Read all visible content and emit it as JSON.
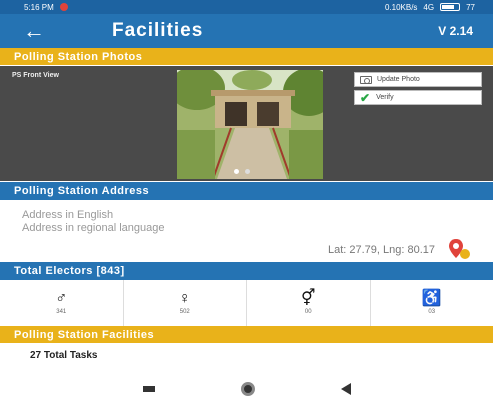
{
  "status_bar": {
    "time": "5:16 PM",
    "network": "0.10KB/s",
    "signal": "4G",
    "battery": "77"
  },
  "app_bar": {
    "title": "Facilities",
    "version": "V 2.14"
  },
  "photos": {
    "header": "Polling Station Photos",
    "label": "PS Front View",
    "update_label": "Update Photo",
    "verify_label": "Verify",
    "photo_count": 2,
    "active_index": 0
  },
  "address": {
    "header": "Polling Station Address",
    "english": "Address in English",
    "regional": "Address in regional language",
    "latlng": "Lat: 27.79, Lng: 80.17"
  },
  "electors": {
    "header": "Total Electors [843]",
    "items": [
      {
        "icon": "male-icon",
        "glyph": "♂",
        "count": "341"
      },
      {
        "icon": "female-icon",
        "glyph": "♀",
        "count": "502"
      },
      {
        "icon": "third-gender-icon",
        "glyph": "⚥",
        "count": "00"
      },
      {
        "icon": "wheelchair-icon",
        "glyph": "♿",
        "count": "03"
      }
    ]
  },
  "facilities": {
    "header": "Polling Station Facilities",
    "tasks": "27 Total Tasks"
  },
  "colors": {
    "primary": "#2573b3",
    "accent": "#e9b21a"
  }
}
